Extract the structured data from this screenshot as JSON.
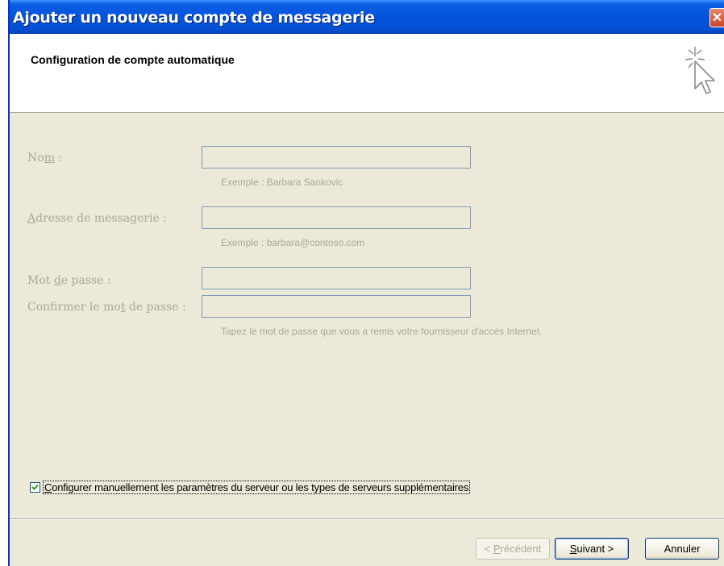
{
  "window": {
    "title": "Ajouter un nouveau compte de messagerie",
    "close_glyph": "✕"
  },
  "header": {
    "title": "Configuration de compte automatique",
    "icon": "cursor-sparkle-icon"
  },
  "form": {
    "name": {
      "label_pre": "No",
      "label_u": "m",
      "label_post": " :",
      "value": "",
      "hint": "Exemple : Barbara Sankovic"
    },
    "email": {
      "label_u": "A",
      "label_post": "dresse de messagerie :",
      "value": "",
      "hint": "Exemple : barbara@contoso.com"
    },
    "password": {
      "label_pre": "Mot ",
      "label_u": "d",
      "label_post": "e passe :",
      "value": ""
    },
    "confirm_password": {
      "label_pre": "Confirmer le mo",
      "label_u": "t",
      "label_post": " de passe :",
      "value": "",
      "hint": "Tapez le mot de passe que vous a remis votre fournisseur d'accès Internet."
    }
  },
  "manual_config": {
    "checked": true,
    "label_u": "C",
    "label_post": "onfigurer manuellement les paramètres du serveur ou les types de serveurs supplémentaires"
  },
  "buttons": {
    "back": {
      "pre": "< ",
      "u": "P",
      "post": "récédent",
      "enabled": false
    },
    "next": {
      "u": "S",
      "post": "uivant >"
    },
    "cancel": {
      "label": "Annuler"
    }
  },
  "colors": {
    "titlebar": "#0553dc",
    "dialog_bg": "#ece9d8",
    "disabled_text": "#aca899",
    "close_button": "#c8452a"
  }
}
